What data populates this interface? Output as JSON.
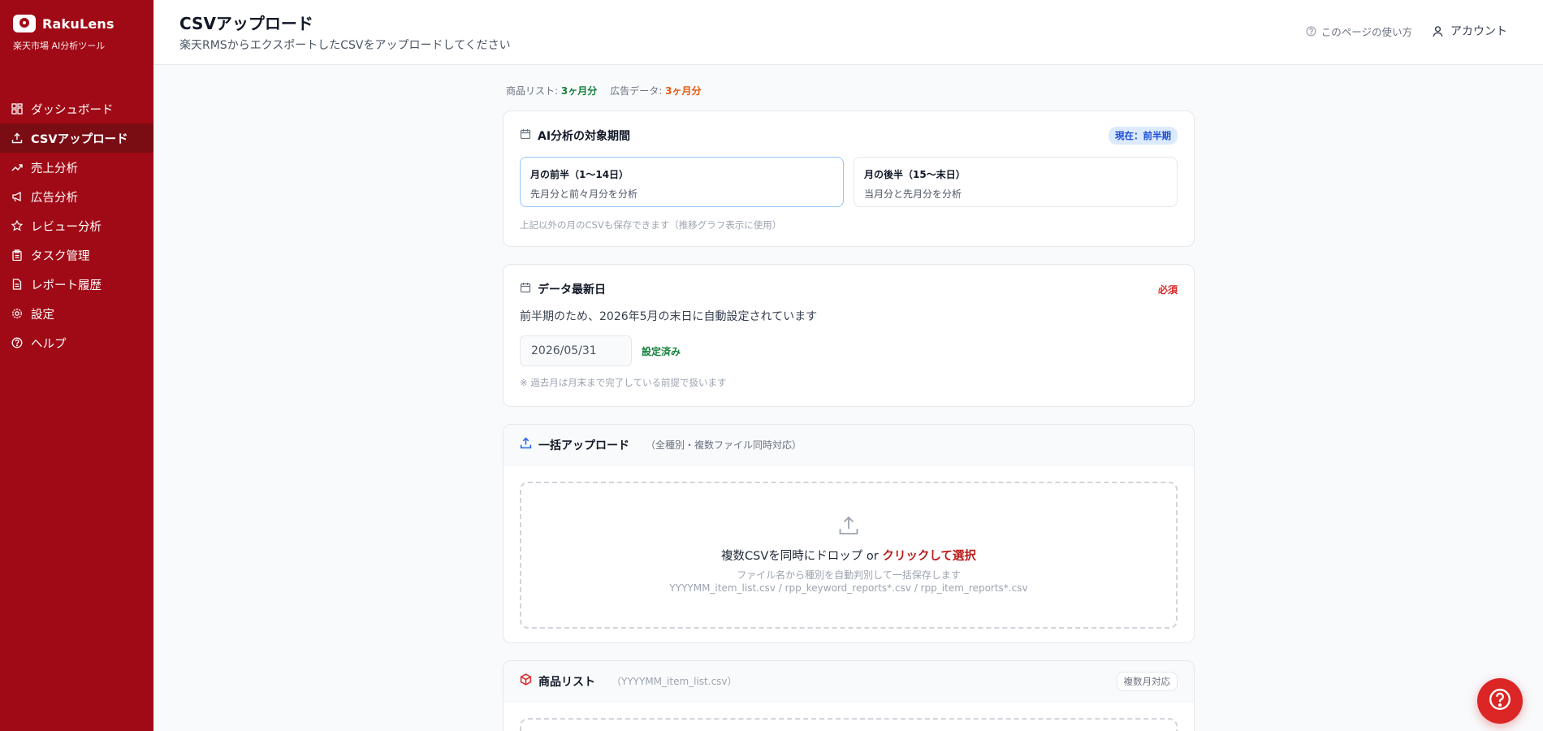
{
  "brand": {
    "name": "RakuLens",
    "subtitle": "楽天市場 AI分析ツール"
  },
  "sidebar": {
    "items": [
      {
        "label": "ダッシュボード",
        "icon": "dashboard-icon",
        "active": false
      },
      {
        "label": "CSVアップロード",
        "icon": "upload-icon",
        "active": true
      },
      {
        "label": "売上分析",
        "icon": "trend-icon",
        "active": false
      },
      {
        "label": "広告分析",
        "icon": "megaphone-icon",
        "active": false
      },
      {
        "label": "レビュー分析",
        "icon": "star-icon",
        "active": false
      },
      {
        "label": "タスク管理",
        "icon": "clipboard-icon",
        "active": false
      },
      {
        "label": "レポート履歴",
        "icon": "document-icon",
        "active": false
      },
      {
        "label": "設定",
        "icon": "gear-icon",
        "active": false
      },
      {
        "label": "ヘルプ",
        "icon": "help-circle-icon",
        "active": false
      }
    ]
  },
  "header": {
    "title": "CSVアップロード",
    "subtitle": "楽天RMSからエクスポートしたCSVをアップロードしてください",
    "help_label": "このページの使い方",
    "account_label": "アカウント"
  },
  "summary": {
    "item_label": "商品リスト:",
    "item_value": "3ヶ月分",
    "ad_label": "広告データ:",
    "ad_value": "3ヶ月分"
  },
  "period": {
    "title": "AI分析の対象期間",
    "current_badge": "現在：前半期",
    "options": [
      {
        "title": "月の前半（1〜14日）",
        "desc": "先月分と前々月分を分析",
        "selected": true
      },
      {
        "title": "月の後半（15〜末日）",
        "desc": "当月分と先月分を分析",
        "selected": false
      }
    ],
    "note": "上記以外の月のCSVも保存できます（推移グラフ表示に使用）"
  },
  "latest": {
    "title": "データ最新日",
    "required": "必須",
    "description": "前半期のため、2026年5月の末日に自動設定されています",
    "date_value": "2026/05/31",
    "status": "設定済み",
    "note": "※ 過去月は月末まで完了している前提で扱います"
  },
  "bulk": {
    "title": "一括アップロード",
    "subtitle": "（全種別・複数ファイル同時対応）",
    "drop_text": "複数CSVを同時にドロップ or ",
    "drop_link": "クリックして選択",
    "drop_sub": "ファイル名から種別を自動判別して一括保存します",
    "drop_patterns": "YYYYMM_item_list.csv / rpp_keyword_reports*.csv / rpp_item_reports*.csv"
  },
  "items": {
    "title": "商品リスト",
    "subtitle": "（YYYYMM_item_list.csv）",
    "badge": "複数月対応"
  },
  "colors": {
    "sidebar_bg": "#a00a16",
    "sidebar_active": "#7a0c14",
    "accent_red": "#dc2626",
    "success_green": "#15803d",
    "warn_orange": "#ea580c",
    "info_blue": "#1d4ed8"
  }
}
